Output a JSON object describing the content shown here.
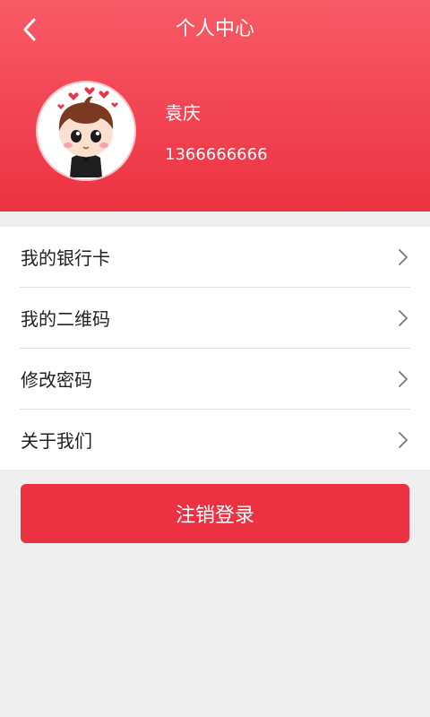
{
  "header": {
    "title": "个人中心",
    "back_icon": "back-arrow-icon",
    "background_color": "#ec3242"
  },
  "profile": {
    "name": "袁庆",
    "phone": "1366666666",
    "avatar": "cartoon-boy-avatar"
  },
  "menu": {
    "items": [
      {
        "label": "我的银行卡",
        "icon": "chevron-right-icon"
      },
      {
        "label": "我的二维码",
        "icon": "chevron-right-icon"
      },
      {
        "label": "修改密码",
        "icon": "chevron-right-icon"
      },
      {
        "label": "关于我们",
        "icon": "chevron-right-icon"
      }
    ]
  },
  "logout": {
    "label": "注销登录",
    "color": "#ec3242"
  }
}
